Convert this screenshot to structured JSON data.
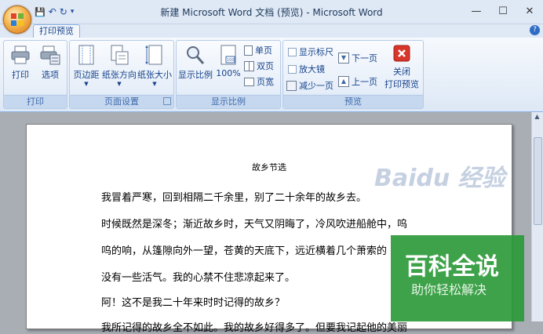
{
  "window": {
    "title": "新建 Microsoft Word 文档 (预览) - Microsoft Word",
    "minimize": "—",
    "maximize": "☐",
    "close": "✕"
  },
  "qat": {
    "save": "💾",
    "undo": "↶",
    "redo": "↻",
    "more": "▾"
  },
  "tab": {
    "label": "打印预览"
  },
  "help": "?",
  "ribbon": {
    "print_group": {
      "label": "打印",
      "print": "打印",
      "options": "选项"
    },
    "page_setup_group": {
      "label": "页面设置",
      "margins": "页边距",
      "orientation": "纸张方向",
      "size": "纸张大小"
    },
    "zoom_group": {
      "label": "显示比例",
      "zoom": "显示比例",
      "percent": "100%",
      "one_page": "单页",
      "two_pages": "双页",
      "page_width": "页宽"
    },
    "preview_group": {
      "label": "预览",
      "show_ruler": "显示标尺",
      "magnifier": "放大镜",
      "shrink": "减少一页",
      "next_page": "下一页",
      "prev_page": "上一页",
      "close_line1": "关闭",
      "close_line2": "打印预览"
    }
  },
  "document": {
    "title": "故乡节选",
    "lines": [
      "我冒着严寒，回到相隔二千余里，别了二十余年的故乡去。",
      "时候既然是深冬；渐近故乡时，天气又阴晦了，冷风吹进船舱中，呜",
      "呜的响，从篷隙向外一望，苍黄的天底下，远近横着几个萧索的",
      "没有一些活气。我的心禁不住悲凉起来了。",
      "阿！这不是我二十年来时时记得的故乡？",
      "我所记得的故乡全不如此。我的故乡好得多了。但要我记起他的美丽"
    ]
  },
  "watermark": {
    "baidu": "Baidu 经验",
    "brand": "百科全说",
    "tagline": "助你轻松解决"
  },
  "colors": {
    "ribbon_text": "#15428b",
    "close_button": "#d9362b",
    "brand_green": "#2d9a3a"
  }
}
